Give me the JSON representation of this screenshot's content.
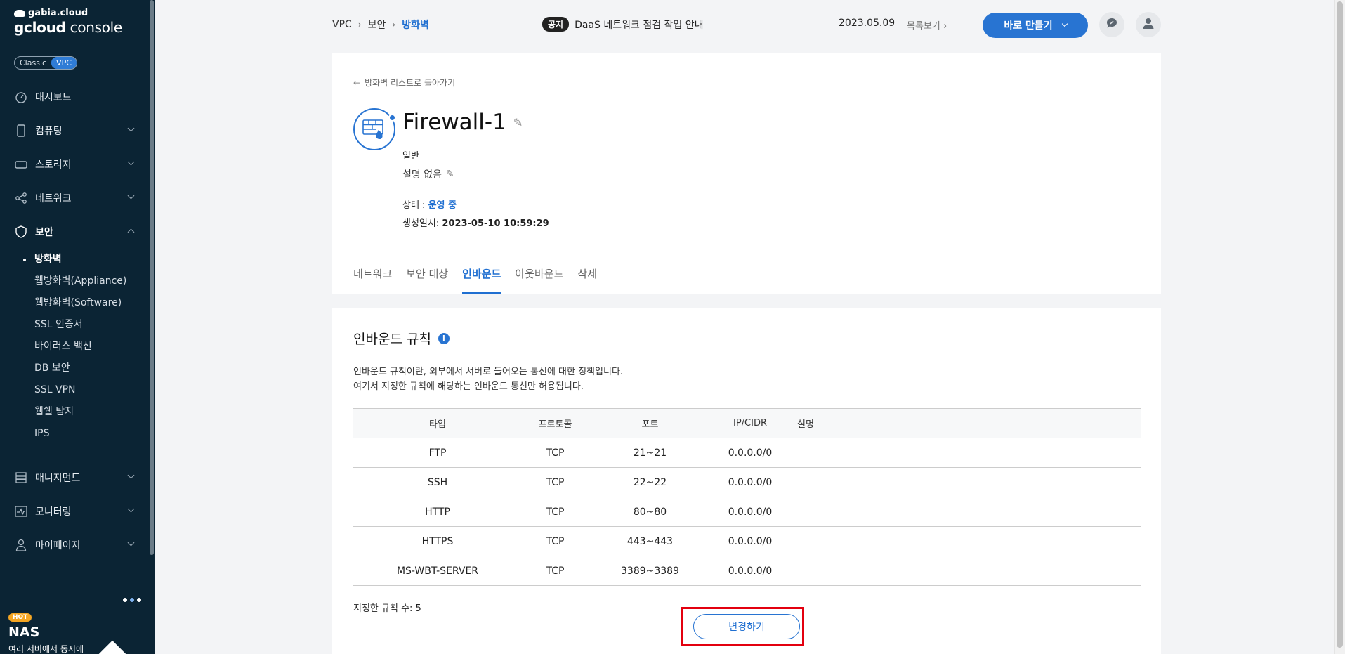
{
  "brand": {
    "top": "gabia.cloud",
    "name_bold": "gcloud",
    "name_rest": " console"
  },
  "env_toggle": {
    "classic": "Classic",
    "vpc": "VPC"
  },
  "sidebar": {
    "items": [
      {
        "label": "대시보드",
        "icon": "dashboard-icon"
      },
      {
        "label": "컴퓨팅",
        "icon": "server-icon"
      },
      {
        "label": "스토리지",
        "icon": "storage-icon"
      },
      {
        "label": "네트워크",
        "icon": "network-icon"
      },
      {
        "label": "보안",
        "icon": "shield-icon"
      },
      {
        "label": "매니지먼트",
        "icon": "management-icon"
      },
      {
        "label": "모니터링",
        "icon": "monitoring-icon"
      },
      {
        "label": "마이페이지",
        "icon": "user-icon"
      }
    ],
    "security_sub": [
      "방화벽",
      "웹방화벽(Appliance)",
      "웹방화벽(Software)",
      "SSL 인증서",
      "바이러스 백신",
      "DB 보안",
      "SSL VPN",
      "웹쉘 탐지",
      "IPS"
    ]
  },
  "promo": {
    "badge": "HOT",
    "title": "NAS",
    "desc": "여러 서버에서 동시에"
  },
  "breadcrumb": {
    "c1": "VPC",
    "c2": "보안",
    "c3": "방화벽"
  },
  "notice": {
    "badge": "공지",
    "text": "DaaS 네트워크 점검 작업 안내",
    "date": "2023.05.09",
    "list_link": "목록보기"
  },
  "create_button": "바로 만들기",
  "detail": {
    "back": "방화벽 리스트로 돌아가기",
    "name": "Firewall-1",
    "type": "일반",
    "description": "설명 없음",
    "status_label": "상태 : ",
    "status_value": "운영 중",
    "created_label": "생성일시: ",
    "created_value": "2023-05-10 10:59:29"
  },
  "tabs": [
    "네트워크",
    "보안 대상",
    "인바운드",
    "아웃바운드",
    "삭제"
  ],
  "inbound": {
    "title": "인바운드 규칙",
    "desc_line1": "인바운드 규칙이란, 외부에서 서버로 들어오는 통신에 대한 정책입니다.",
    "desc_line2": "여기서 지정한 규칙에 해당하는 인바운드 통신만 허용됩니다.",
    "columns": [
      "타입",
      "프로토콜",
      "포트",
      "IP/CIDR",
      "설명"
    ],
    "rows": [
      [
        "FTP",
        "TCP",
        "21~21",
        "0.0.0.0/0",
        ""
      ],
      [
        "SSH",
        "TCP",
        "22~22",
        "0.0.0.0/0",
        ""
      ],
      [
        "HTTP",
        "TCP",
        "80~80",
        "0.0.0.0/0",
        ""
      ],
      [
        "HTTPS",
        "TCP",
        "443~443",
        "0.0.0.0/0",
        ""
      ],
      [
        "MS-WBT-SERVER",
        "TCP",
        "3389~3389",
        "0.0.0.0/0",
        ""
      ]
    ],
    "count_label": "지정한 규칙 수: 5",
    "change_button": "변경하기"
  }
}
